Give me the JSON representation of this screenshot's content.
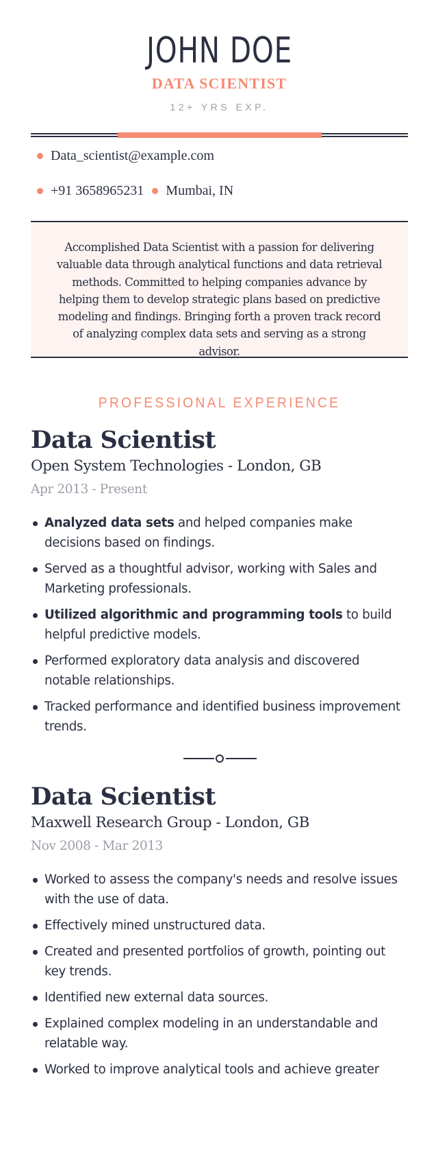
{
  "header": {
    "first_name": "JOHN",
    "last_name": "DOE",
    "title": "DATA SCIENTIST",
    "experience": "12+ YRS EXP."
  },
  "contacts": {
    "email": "Data_scientist@example.com",
    "phone": "+91 3658965231",
    "location": "Mumbai, IN"
  },
  "summary": "Accomplished Data Scientist with a passion for delivering valuable data through analytical functions and data retrieval methods. Committed to helping companies advance by helping them to develop strategic plans based on predictive modeling and findings. Bringing forth a proven track record of analyzing complex data sets and serving as a strong advisor.",
  "colors": {
    "accent": "#f58a72",
    "text": "#2b2f41",
    "muted": "#9a9ea8",
    "summary_bg": "#fdf3f1"
  },
  "experience": {
    "heading": "PROFESSIONAL EXPERIENCE",
    "jobs": [
      {
        "title": "Data Scientist",
        "company": "Open System Technologies - London, GB",
        "dates": "Apr 2013 - Present",
        "bullets": [
          {
            "bold": "Analyzed data sets",
            "text": " and helped companies make decisions based on findings."
          },
          {
            "bold": "",
            "text": "Served as a thoughtful advisor, working with Sales and Marketing professionals."
          },
          {
            "bold": "Utilized algorithmic and programming tools",
            "text": " to build helpful predictive models."
          },
          {
            "bold": "",
            "text": "Performed exploratory data analysis and discovered notable relationships."
          },
          {
            "bold": "",
            "text": "Tracked performance and identified business improvement trends."
          }
        ]
      },
      {
        "title": "Data Scientist",
        "company": "Maxwell Research Group - London, GB",
        "dates": "Nov 2008 - Mar 2013",
        "bullets": [
          {
            "bold": "",
            "text": " Worked to assess the company's needs and resolve issues with the use of data."
          },
          {
            "bold": "",
            "text": "Effectively mined unstructured data."
          },
          {
            "bold": "",
            "text": "Created and presented portfolios of growth, pointing out key trends."
          },
          {
            "bold": "",
            "text": "Identified new external data sources."
          },
          {
            "bold": "",
            "text": "Explained complex modeling in an understandable and relatable way."
          },
          {
            "bold": "",
            "text": "Worked to improve analytical tools and achieve greater"
          }
        ]
      }
    ]
  }
}
